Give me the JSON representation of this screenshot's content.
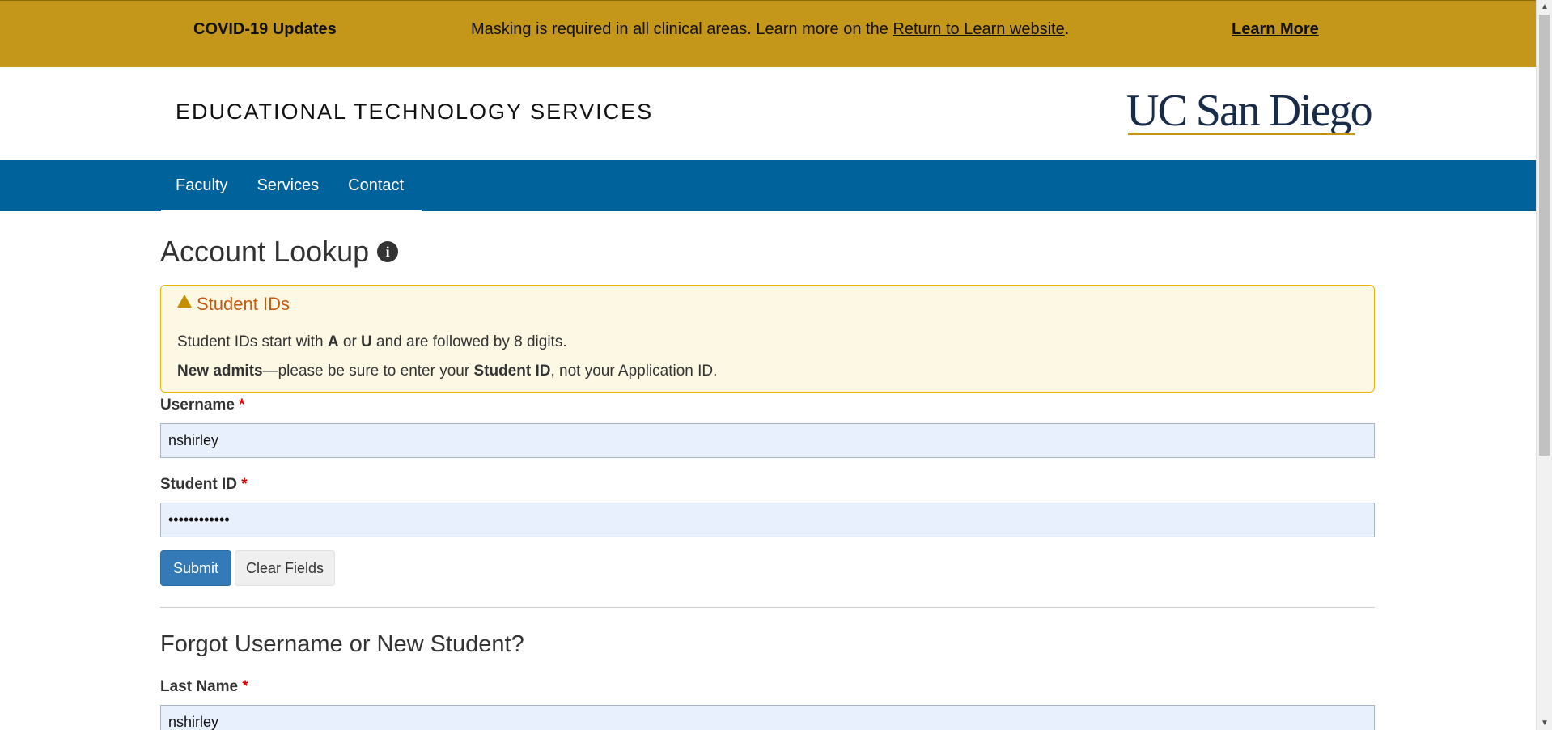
{
  "covid_banner": {
    "title": "COVID-19 Updates",
    "message_prefix": "Masking is required in all clinical areas. Learn more on the ",
    "message_link": "Return to Learn website",
    "message_suffix": ".",
    "learn_more": "Learn More"
  },
  "header": {
    "site_title": "EDUCATIONAL TECHNOLOGY SERVICES",
    "logo_text": "UC San Diego"
  },
  "nav": {
    "items": [
      {
        "label": "Faculty"
      },
      {
        "label": "Services"
      },
      {
        "label": "Contact"
      }
    ]
  },
  "main": {
    "title": "Account Lookup",
    "info_icon": "info-circle-icon",
    "alert": {
      "icon": "warning-icon",
      "heading": "Student IDs",
      "line1_pre": "Student IDs start with ",
      "line1_a": "A",
      "line1_or": " or ",
      "line1_u": "U",
      "line1_post": " and are followed by 8 digits.",
      "line2_bold1": "New admits",
      "line2_mid": "—please be sure to enter your ",
      "line2_bold2": "Student ID",
      "line2_post": ", not your Application ID."
    },
    "username": {
      "label": "Username",
      "required_mark": "*",
      "value": "nshirley"
    },
    "student_id": {
      "label": "Student ID",
      "required_mark": "*",
      "value": "••••••••••••"
    },
    "submit_label": "Submit",
    "clear_label": "Clear Fields",
    "forgot_title": "Forgot Username or New Student?",
    "last_name": {
      "label": "Last Name",
      "required_mark": "*",
      "value": "nshirley"
    }
  },
  "colors": {
    "banner": "#c4961a",
    "nav": "#00629b",
    "submit": "#337ab7",
    "alert_bg": "#fcf8e3",
    "alert_heading": "#c55a11"
  }
}
